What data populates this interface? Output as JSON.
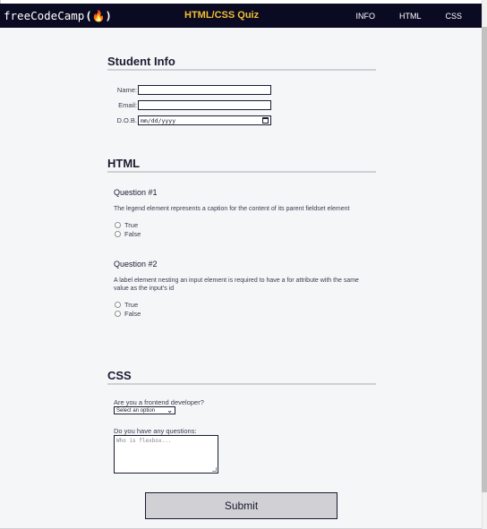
{
  "navbar": {
    "logo_text": "freeCodeCamp",
    "logo_flame": "(🔥)",
    "title": "HTML/CSS Quiz",
    "links": [
      "INFO",
      "HTML",
      "CSS"
    ]
  },
  "student_info": {
    "heading": "Student Info",
    "name_label": "Name:",
    "email_label": "Email:",
    "dob_label": "D.O.B.",
    "dob_placeholder": "mm/dd/yyyy"
  },
  "html_section": {
    "heading": "HTML",
    "questions": [
      {
        "title": "Question #1",
        "text": "The legend element represents a caption for the content of its parent fieldset element",
        "options": [
          "True",
          "False"
        ]
      },
      {
        "title": "Question #2",
        "text": "A label element nesting an input element is required to have a for attribute with the same value as the input's id",
        "options": [
          "True",
          "False"
        ]
      }
    ]
  },
  "css_section": {
    "heading": "CSS",
    "frontend_question": "Are you a frontend developer?",
    "select_value": "Select an option",
    "questions_label": "Do you have any questions:",
    "questions_placeholder": "Who is flexbox..."
  },
  "submit_label": "Submit"
}
